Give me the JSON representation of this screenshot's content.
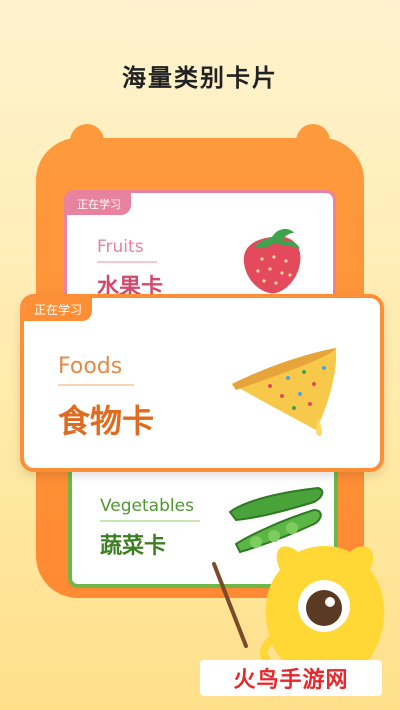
{
  "page": {
    "title": "海量类别卡片"
  },
  "cards": {
    "fruit": {
      "tag": "正在学习",
      "en": "Fruits",
      "cn": "水果卡"
    },
    "food": {
      "tag": "正在学习",
      "en": "Foods",
      "cn": "食物卡"
    },
    "vegetable": {
      "en": "Vegetables",
      "cn": "蔬菜卡"
    }
  },
  "watermark": {
    "text": "火鸟手游网"
  },
  "icons": [
    "strawberry-icon",
    "pizza-slice-icon",
    "edamame-icon",
    "mascot-icon",
    "pointer-stick-icon"
  ],
  "colors": {
    "accent_orange": "#ff8f36",
    "fruit_pink": "#e7829f",
    "veg_green": "#6fb848",
    "watermark_red": "#e8272b"
  }
}
